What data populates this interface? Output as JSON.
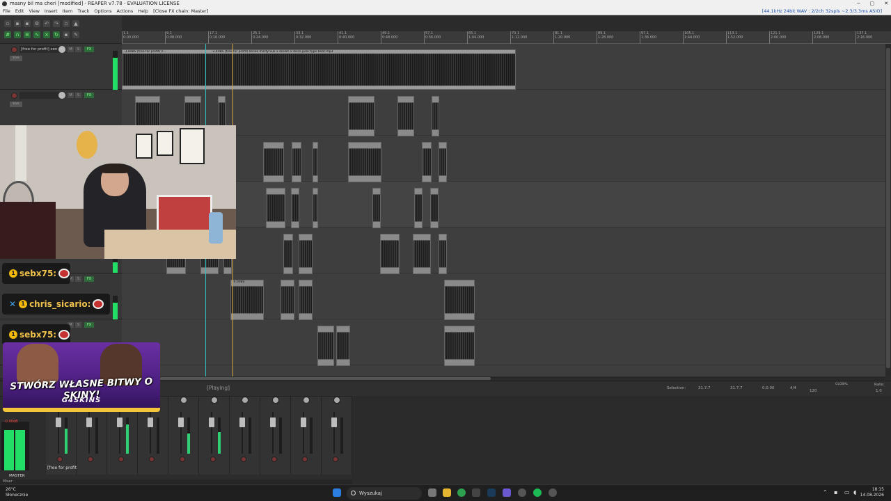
{
  "window": {
    "title": "masny bil ma cheri [modified] - REAPER v7.78 - EVALUATION LICENSE",
    "status": "[44.1kHz 24bit WAV : 2/2ch 32spls ~2.3/3.3ms ASIO]"
  },
  "menu": [
    "File",
    "Edit",
    "View",
    "Insert",
    "Item",
    "Track",
    "Options",
    "Actions",
    "Help",
    "[Close FX chain: Master]"
  ],
  "ruler": {
    "ticks": [
      "1.1",
      "9.1",
      "17.1",
      "25.1",
      "33.1",
      "41.1",
      "49.1",
      "57.1",
      "65.1",
      "73.1",
      "81.1",
      "89.1",
      "97.1",
      "105.1",
      "113.1",
      "121.1",
      "129.1",
      "137.1"
    ],
    "times": [
      "0:00.000",
      "0:08.000",
      "0:16.000",
      "0:24.000",
      "0:32.000",
      "0:40.000",
      "0:48.000",
      "0:56.000",
      "1:04.000",
      "1:12.000",
      "1:20.000",
      "1:28.000",
      "1:36.000",
      "1:44.000",
      "1:52.000",
      "2:00.000",
      "2:08.000",
      "2:16.000"
    ]
  },
  "tracks": [
    {
      "name": "[free for profit] zen",
      "meter": 0.82
    },
    {
      "name": "",
      "meter": 0.0
    },
    {
      "name": "",
      "meter": 0.0
    },
    {
      "name": "",
      "meter": 0.0
    },
    {
      "name": "",
      "meter": 0.0
    },
    {
      "name": "",
      "meter": 0.7
    },
    {
      "name": "",
      "meter": 0.0
    },
    {
      "name": "",
      "meter": 0.7
    }
  ],
  "items": {
    "main_label": "-2.4dBS [free for profit] zenek martyniuk x skolim x disco polo type beat.mp3",
    "main_label_short": "-3.8dBS [free for profit] z...",
    "small_label": "-4.0dBS"
  },
  "track_buttons": {
    "mute": "M",
    "solo": "S",
    "fx": "FX",
    "auto": "trim"
  },
  "transport": {
    "state": "[Playing]",
    "selection_label": "Selection:",
    "sel_start": "31.7.7",
    "sel_end": "31.7.7",
    "sel_len": "0.0.00",
    "time_sig": "4/4",
    "bpm": "120",
    "rate_label": "Rate:",
    "rate_value": "1.0",
    "global_label": "GLOBAL"
  },
  "mixer": {
    "master_label": "MASTER",
    "master_db": "-0.00dB",
    "first_strip_name": "[free for profit",
    "strip_numbers": [
      "1",
      "2",
      "3",
      "4",
      "5",
      "6",
      "7",
      "8",
      "9",
      "10"
    ],
    "strip_meters": [
      0.7,
      0.0,
      0.8,
      0.0,
      0.55,
      0.6,
      0.0,
      0.0,
      0.0,
      0.0
    ],
    "tab_label": "Mixer"
  },
  "chat": [
    {
      "user": "sebx75:",
      "pinned": false
    },
    {
      "user": "chris_sicario:",
      "pinned": true
    },
    {
      "user": "sebx75:",
      "pinned": false
    }
  ],
  "ad": {
    "headline": "STWÓRZ WŁASNE BITWY O SKINY!",
    "brand": "G4SKINS"
  },
  "taskbar": {
    "weather_temp": "26°C",
    "weather_desc": "Słonecznie",
    "search_placeholder": "Wyszukaj",
    "time": "18:15",
    "date": "14.08.2026"
  },
  "colors": {
    "meter_green": "#22dd66",
    "edit_cursor": "#d8a93a",
    "play_cursor": "#2fbfbf",
    "chat_name": "#f1c24b",
    "ad_purple": "#6a2fa3"
  }
}
